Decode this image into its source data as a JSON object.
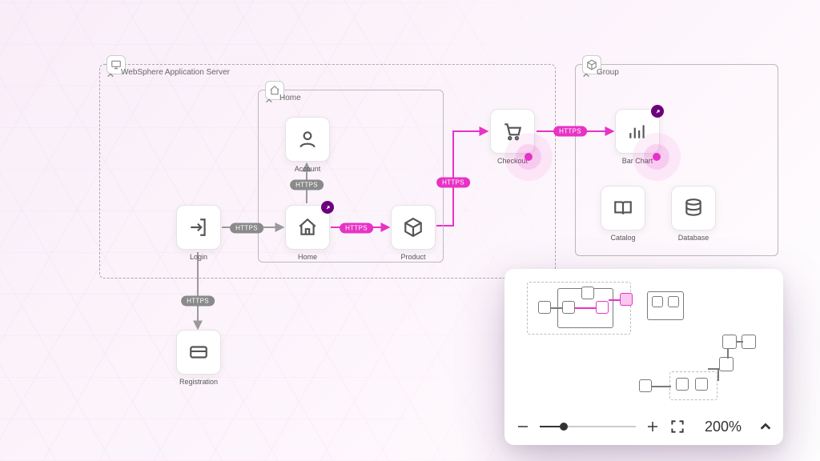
{
  "groups": {
    "server": {
      "label": "WebSphere Application Server"
    },
    "home": {
      "label": "Home"
    },
    "group2": {
      "label": "Group"
    }
  },
  "nodes": {
    "login": {
      "label": "Login"
    },
    "registration": {
      "label": "Registration"
    },
    "home": {
      "label": "Home"
    },
    "account": {
      "label": "Account"
    },
    "product": {
      "label": "Product"
    },
    "checkout": {
      "label": "Checkout"
    },
    "barchart": {
      "label": "Bar Chart"
    },
    "catalog": {
      "label": "Catalog"
    },
    "database": {
      "label": "Database"
    }
  },
  "edges": {
    "login_home": {
      "label": "HTTPS"
    },
    "login_registration": {
      "label": "HTTPS"
    },
    "home_account": {
      "label": "HTTPS"
    },
    "home_product": {
      "label": "HTTPS"
    },
    "product_checkout": {
      "label": "HTTPS"
    },
    "checkout_barchart": {
      "label": "HTTPS"
    }
  },
  "minimap": {
    "zoom_label": "200%"
  },
  "icons": {
    "server": "monitor-icon",
    "home": "home-icon",
    "group2": "cube-icon"
  },
  "colors": {
    "accent": "#e733c5",
    "badge": "#6b007b",
    "pill_gray": "#8a8a8a"
  }
}
